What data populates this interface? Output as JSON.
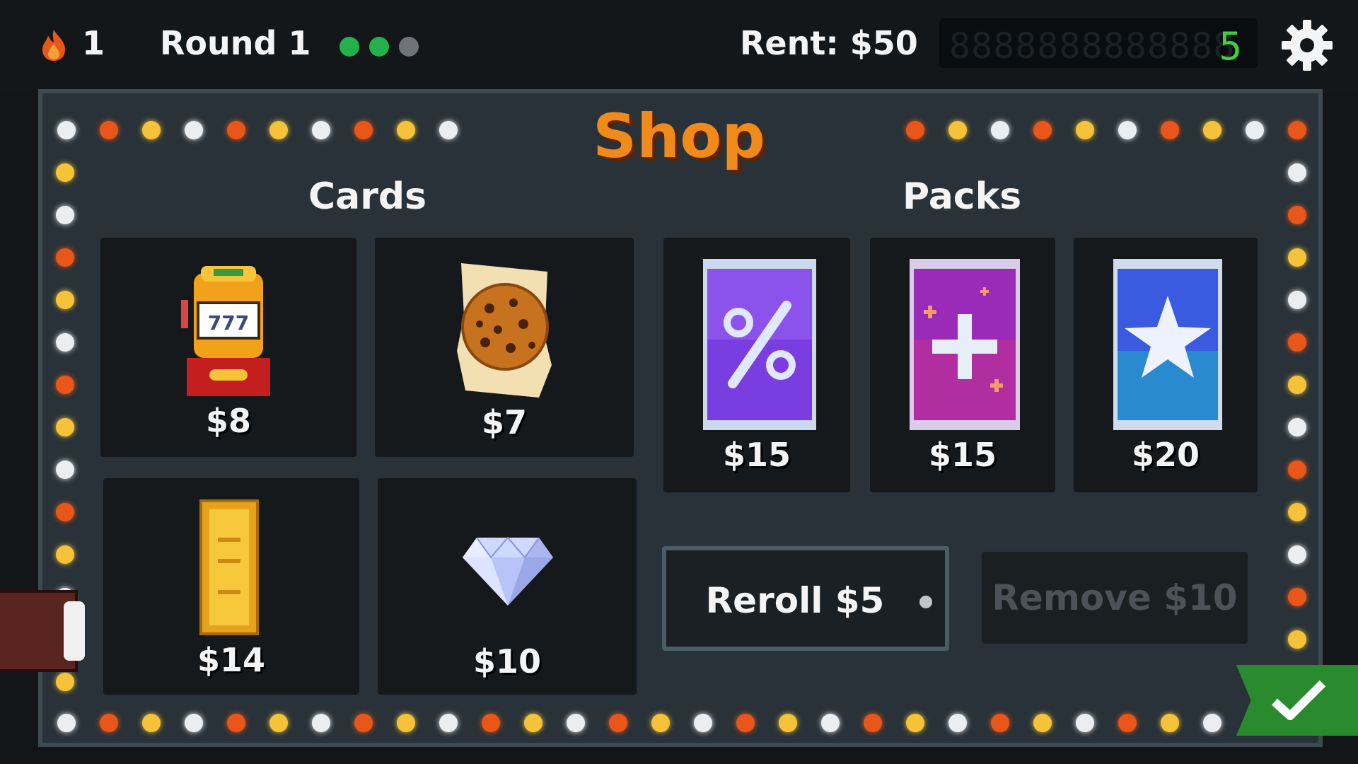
{
  "hud": {
    "lives": "1",
    "round": "Round 1",
    "progress_dots": [
      {
        "state": "done",
        "color": "#22b14c"
      },
      {
        "state": "done",
        "color": "#22b14c"
      },
      {
        "state": "pending",
        "color": "#6e7478"
      }
    ],
    "rent": "Rent: $50",
    "counter_digit": "5",
    "counter_ghost": "8888888888888",
    "settings_icon": "gear-icon"
  },
  "shop": {
    "title": "Shop",
    "cards_label": "Cards",
    "packs_label": "Packs",
    "cards": [
      {
        "name": "slot-machine",
        "icon": "slot-machine-icon",
        "price": "$8",
        "reels": "777"
      },
      {
        "name": "cookie",
        "icon": "cookie-icon",
        "price": "$7"
      },
      {
        "name": "gold-bar",
        "icon": "gold-bar-icon",
        "price": "$14"
      },
      {
        "name": "diamond",
        "icon": "diamond-icon",
        "price": "$10"
      }
    ],
    "packs": [
      {
        "name": "percent-pack",
        "icon": "percent-icon",
        "price": "$15",
        "color": "#7a3ee0"
      },
      {
        "name": "plus-pack",
        "icon": "plus-icon",
        "price": "$15",
        "color": "#b02ea0"
      },
      {
        "name": "star-pack",
        "icon": "star-icon",
        "price": "$20",
        "color": "#3a5ae0"
      }
    ],
    "reroll_label": "Reroll $5",
    "remove_label": "Remove $10"
  },
  "colors": {
    "accent": "#f08a1a",
    "bulb_white": "#e8eef2",
    "bulb_orange": "#e8561a",
    "bulb_yellow": "#f5c23a",
    "confirm": "#2a8a2e"
  },
  "confirm_icon": "checkmark-icon",
  "wallet_icon": "wallet-icon"
}
